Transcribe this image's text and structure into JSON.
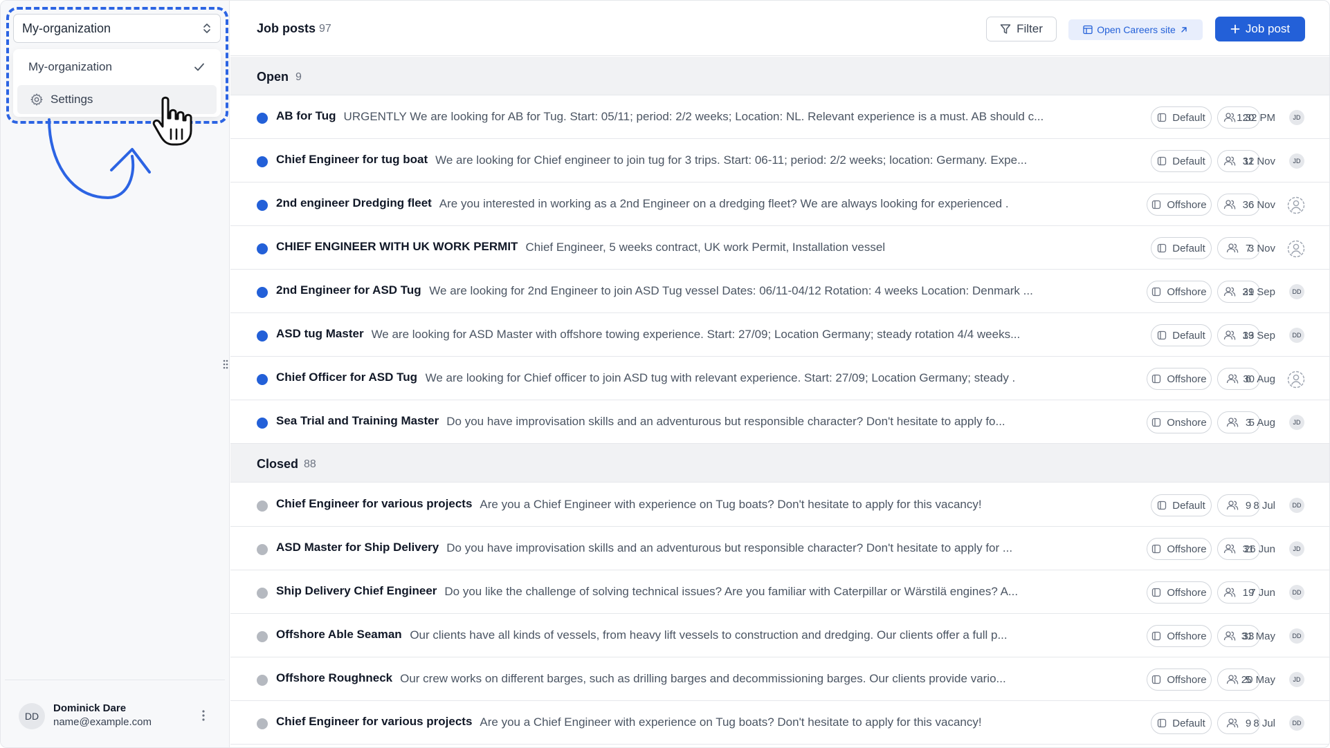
{
  "sidebar": {
    "org_select_label": "My-organization",
    "dropdown": {
      "org_item": "My-organization",
      "settings_item": "Settings"
    },
    "user": {
      "initials": "DD",
      "name": "Dominick Dare",
      "email": "name@example.com"
    }
  },
  "header": {
    "title": "Job posts",
    "count": "97",
    "filter_label": "Filter",
    "careers_label": "Open Careers site",
    "jobpost_label": "Job post"
  },
  "sections": {
    "open": {
      "label": "Open",
      "count": "9"
    },
    "closed": {
      "label": "Closed",
      "count": "88"
    }
  },
  "open_rows": [
    {
      "title": "AB for Tug",
      "desc": "URGENTLY We are looking for AB for Tug. Start: 05/11; period: 2/2 weeks; Location: NL. Relevant experience is a must. AB should c...",
      "tag": "Default",
      "count": "20",
      "date": "1:32 PM",
      "avatar": "JD"
    },
    {
      "title": "Chief Engineer for tug boat",
      "desc": "We are looking for Chief engineer to join tug for 3 trips. Start: 06-11; period: 2/2 weeks; location: Germany. Expe...",
      "tag": "Default",
      "count": "32",
      "date": "11 Nov",
      "avatar": "JD"
    },
    {
      "title": "2nd engineer Dredging fleet",
      "desc": "Are you interested in working as a 2nd Engineer on a dredging fleet? We are always looking for experienced .",
      "tag": "Offshore",
      "count": "36",
      "date": "6 Nov",
      "avatar": ""
    },
    {
      "title": "CHIEF ENGINEER WITH UK WORK PERMIT",
      "desc": "Chief Engineer, 5 weeks contract, UK work Permit, Installation vessel",
      "tag": "Default",
      "count": "7",
      "date": "3 Nov",
      "avatar": ""
    },
    {
      "title": "2nd Engineer for ASD Tug",
      "desc": "We are looking for 2nd Engineer to join ASD Tug vessel Dates: 06/11-04/12 Rotation: 4 weeks Location: Denmark ...",
      "tag": "Offshore",
      "count": "29",
      "date": "31 Sep",
      "avatar": "DD"
    },
    {
      "title": "ASD tug Master",
      "desc": "We are looking for ASD Master with offshore towing experience. Start: 27/09; Location Germany; steady rotation 4/4 weeks...",
      "tag": "Default",
      "count": "33",
      "date": "19 Sep",
      "avatar": "DD"
    },
    {
      "title": "Chief Officer for ASD Tug",
      "desc": "We are looking for Chief officer to join ASD tug with relevant experience. Start: 27/09; Location Germany; steady .",
      "tag": "Offshore",
      "count": "6",
      "date": "30 Aug",
      "avatar": ""
    },
    {
      "title": "Sea Trial and Training Master",
      "desc": "Do you have improvisation skills and an adventurous but responsible character? Don't hesitate to apply fo...",
      "tag": "Onshore",
      "count": "3",
      "date": "5 Aug",
      "avatar": "JD"
    }
  ],
  "closed_rows": [
    {
      "title": "Chief Engineer for various projects",
      "desc": "Are you a Chief Engineer with experience on Tug boats? Don't hesitate to apply for this vacancy!",
      "tag": "Default",
      "count": "9",
      "date": "8 Jul",
      "avatar": "DD"
    },
    {
      "title": "ASD Master for Ship Delivery",
      "desc": "Do you have improvisation skills and an adventurous but responsible character? Don't hesitate to apply for ...",
      "tag": "Offshore",
      "count": "31",
      "date": "26 Jun",
      "avatar": "JD"
    },
    {
      "title": "Ship Delivery Chief Engineer",
      "desc": "Do you like the challenge of solving technical issues? Are you familiar with Caterpillar or Wärstilä engines? A...",
      "tag": "Offshore",
      "count": "19",
      "date": "7 Jun",
      "avatar": "DD"
    },
    {
      "title": "Offshore Able Seaman",
      "desc": "Our clients have all kinds of vessels, from heavy lift vessels to construction and dredging. Our clients offer a full p...",
      "tag": "Offshore",
      "count": "33",
      "date": "31 May",
      "avatar": "DD"
    },
    {
      "title": "Offshore Roughneck",
      "desc": "Our crew works on different barges, such as drilling barges and decommissioning barges. Our clients provide vario...",
      "tag": "Offshore",
      "count": "5",
      "date": "20 May",
      "avatar": "JD"
    },
    {
      "title": "Chief Engineer for various projects",
      "desc": "Are you a Chief Engineer with experience on Tug boats? Don't hesitate to apply for this vacancy!",
      "tag": "Default",
      "count": "9",
      "date": "8 Jul",
      "avatar": "DD"
    }
  ],
  "colors": {
    "accent": "#2360d8",
    "highlight_dashed": "#2c64e3",
    "open_dot": "#2360d8",
    "closed_dot": "#b5b9c0"
  }
}
